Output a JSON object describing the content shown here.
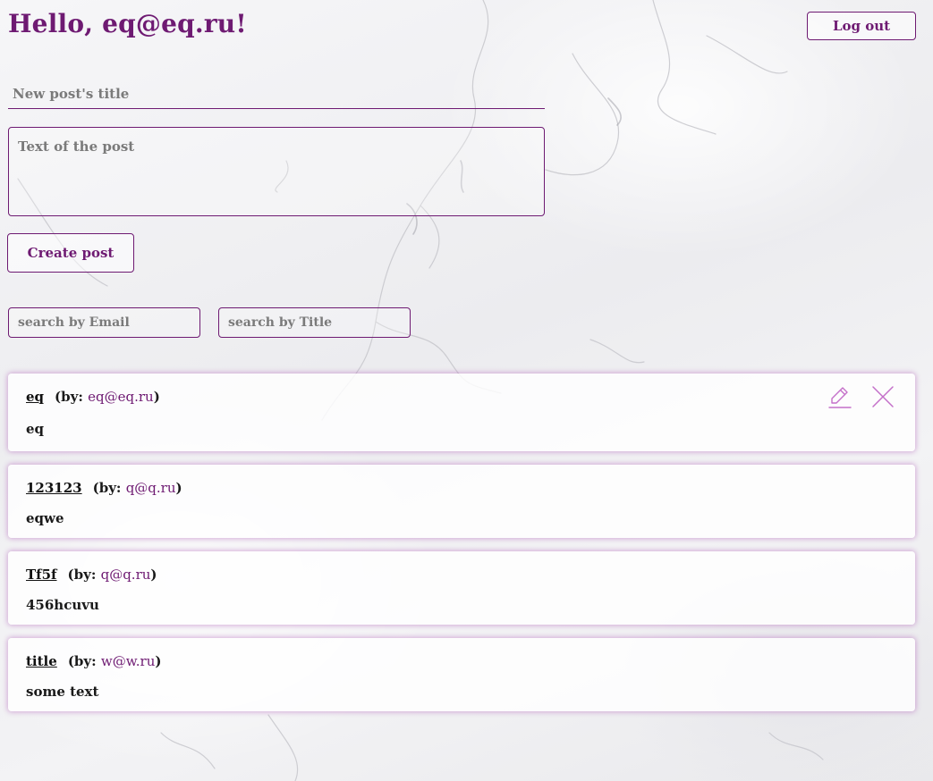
{
  "header": {
    "greeting": "Hello, eq@eq.ru!",
    "logout_label": "Log out"
  },
  "new_post": {
    "title_placeholder": "New post's title",
    "title_value": "",
    "text_placeholder": "Text of the post",
    "text_value": "",
    "create_label": "Create post"
  },
  "search": {
    "email_placeholder": "search by Email",
    "title_placeholder": "search by Title"
  },
  "posts": [
    {
      "title": "eq",
      "by_label": "(by:",
      "author": "eq@eq.ru",
      "close_paren": ")",
      "text": "eq",
      "editable": true,
      "edit_icon": "pencil-icon",
      "delete_icon": "close-icon"
    },
    {
      "title": "123123",
      "by_label": "(by:",
      "author": "q@q.ru",
      "close_paren": ")",
      "text": "eqwe"
    },
    {
      "title": "Tf5f",
      "by_label": "(by:",
      "author": "q@q.ru",
      "close_paren": ")",
      "text": "456hcuvu"
    },
    {
      "title": "title",
      "by_label": "(by:",
      "author": "w@w.ru",
      "close_paren": ")",
      "text": "some text"
    }
  ],
  "colors": {
    "accent": "#6e1a72",
    "icon": "#c46fc9",
    "card_glow": "#b05ab8"
  }
}
